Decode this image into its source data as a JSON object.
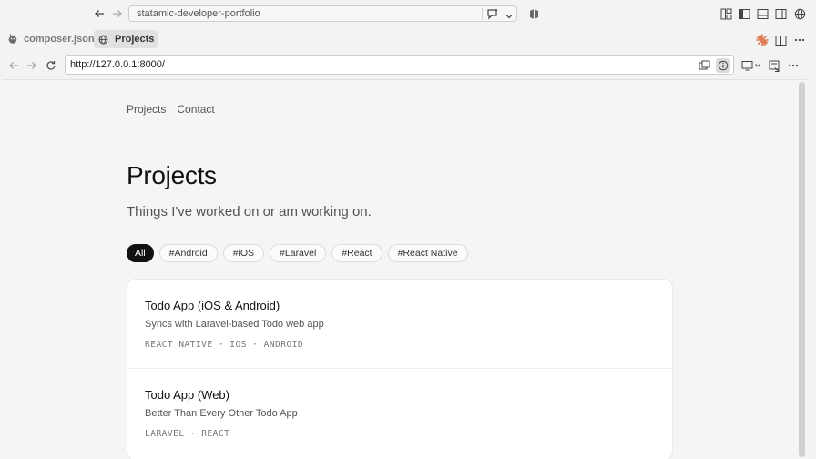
{
  "titlebar": {
    "command_center": "statamic-developer-portfolio"
  },
  "tabs": [
    {
      "label": "composer.json",
      "icon": "php-file-icon"
    },
    {
      "label": "Projects",
      "icon": "globe-icon"
    }
  ],
  "browser": {
    "url": "http://127.0.0.1:8000/"
  },
  "site": {
    "nav": [
      "Projects",
      "Contact"
    ],
    "title": "Projects",
    "subtitle": "Things I've worked on or am working on.",
    "filters": [
      "All",
      "#Android",
      "#iOS",
      "#Laravel",
      "#React",
      "#React Native"
    ],
    "active_filter": "All",
    "projects": [
      {
        "title": "Todo App (iOS & Android)",
        "description": "Syncs with Laravel-based Todo web app",
        "tags": "REACT NATIVE · IOS · ANDROID"
      },
      {
        "title": "Todo App (Web)",
        "description": "Better Than Every Other Todo App",
        "tags": "LARAVEL · REACT"
      }
    ]
  },
  "colors": {
    "chip_active_bg": "#111111",
    "accent_icon": "#e07b53"
  }
}
